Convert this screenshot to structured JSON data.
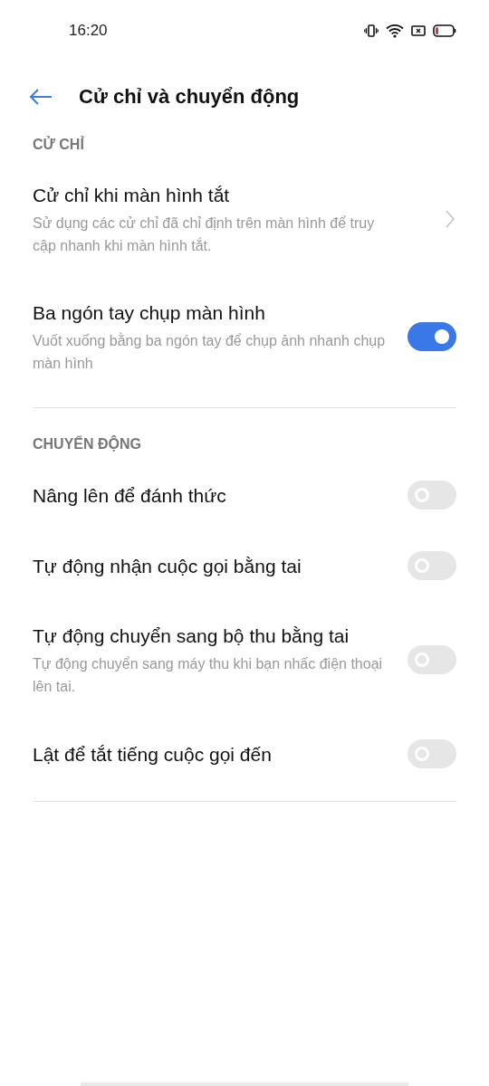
{
  "status_bar": {
    "time": "16:20"
  },
  "header": {
    "title": "Cử chỉ và chuyển động"
  },
  "sections": [
    {
      "title": "CỬ CHỈ",
      "items": [
        {
          "kind": "link",
          "title": "Cử chỉ khi màn hình tắt",
          "subtitle": "Sử dụng các cử chỉ đã chỉ định trên màn hình để truy cập nhanh khi màn hình tắt."
        },
        {
          "kind": "toggle",
          "title": "Ba ngón tay chụp màn hình",
          "subtitle": "Vuốt xuống bằng ba ngón tay để chụp ảnh nhanh chụp màn hình",
          "on": true
        }
      ]
    },
    {
      "title": "CHUYỂN ĐỘNG",
      "items": [
        {
          "kind": "toggle",
          "title": "Nâng lên để đánh thức",
          "on": false
        },
        {
          "kind": "toggle",
          "title": "Tự động nhận cuộc gọi bằng tai",
          "on": false
        },
        {
          "kind": "toggle",
          "title": "Tự động chuyển sang bộ thu bằng tai",
          "subtitle": "Tự động chuyển sang máy thu khi bạn nhấc điện thoại lên tai.",
          "on": false
        },
        {
          "kind": "toggle",
          "title": "Lật để tắt tiếng cuộc gọi đến",
          "on": false
        }
      ]
    }
  ]
}
